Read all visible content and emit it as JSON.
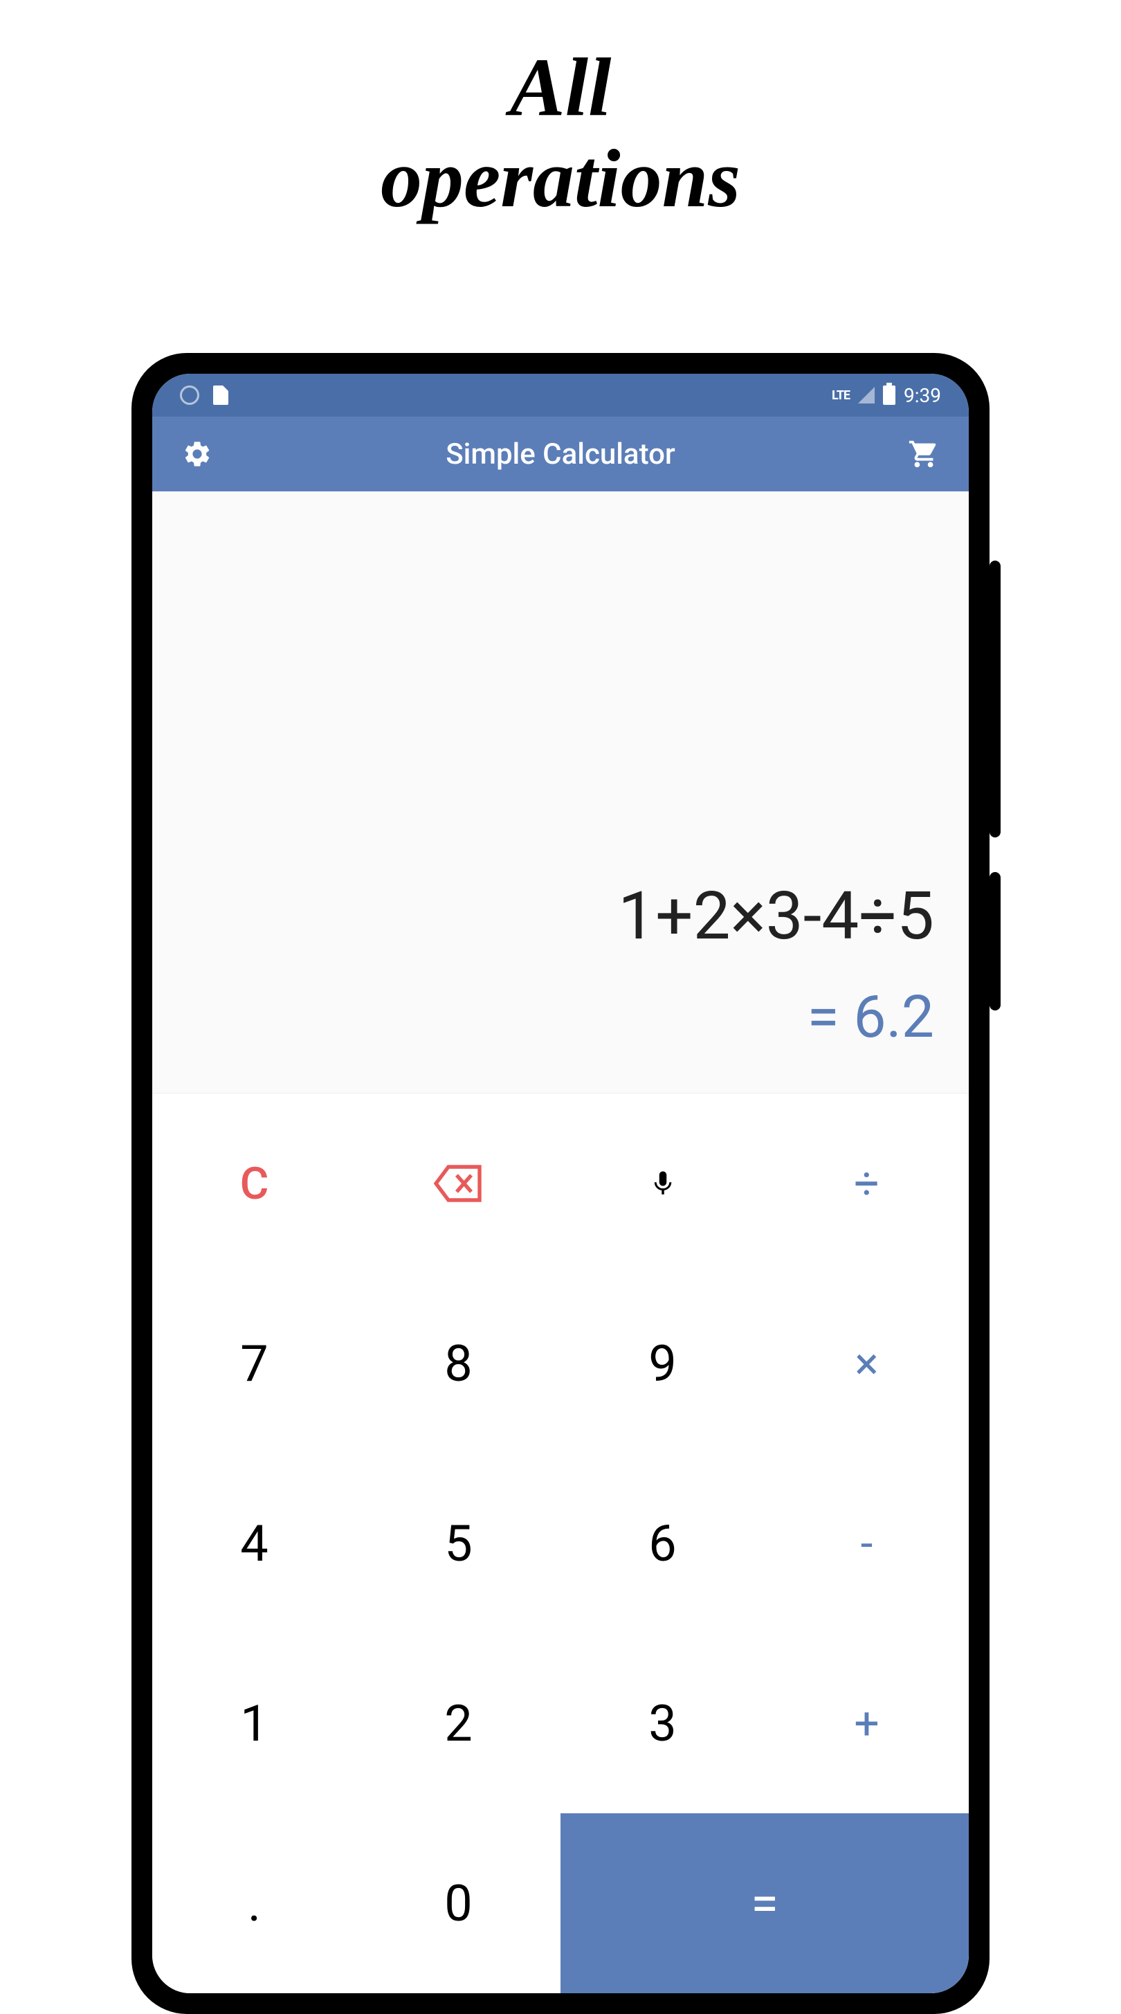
{
  "promo": {
    "line1": "All",
    "line2": "operations"
  },
  "status_bar": {
    "lte": "LTE",
    "time": "9:39"
  },
  "app_bar": {
    "title": "Simple Calculator"
  },
  "display": {
    "expression": "1+2×3-4÷5",
    "result": "= 6.2"
  },
  "keypad": {
    "clear": "C",
    "divide": "÷",
    "seven": "7",
    "eight": "8",
    "nine": "9",
    "multiply": "×",
    "four": "4",
    "five": "5",
    "six": "6",
    "minus": "-",
    "one": "1",
    "two": "2",
    "three": "3",
    "plus": "+",
    "dot": ".",
    "zero": "0",
    "equals": "="
  },
  "colors": {
    "status_bar_bg": "#4a6fa8",
    "app_bar_bg": "#5b7eb8",
    "accent": "#5b7eb8",
    "danger": "#e85a5a"
  }
}
